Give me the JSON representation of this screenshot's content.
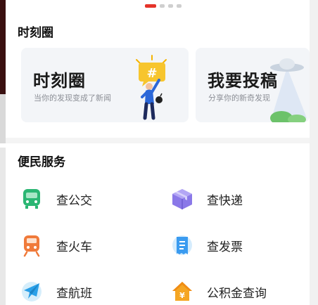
{
  "carousel": {
    "pages": 4,
    "active_index": 0,
    "active_color": "#e5332a"
  },
  "moments": {
    "section_title": "时刻圈",
    "cards": [
      {
        "title": "时刻圈",
        "subtitle": "当你的发现变成了新闻",
        "illustration": "person-hashtag-illustration"
      },
      {
        "title": "我要投稿",
        "subtitle": "分享你的新奇发现",
        "illustration": "ufo-beam-illustration"
      }
    ]
  },
  "services": {
    "section_title": "便民服务",
    "items": [
      {
        "label": "查公交",
        "icon": "bus-icon",
        "color": "#2bb673"
      },
      {
        "label": "查快递",
        "icon": "package-icon",
        "color": "#8a78e8"
      },
      {
        "label": "查火车",
        "icon": "train-icon",
        "color": "#f07a3a"
      },
      {
        "label": "查发票",
        "icon": "invoice-icon",
        "color": "#3a9bf0"
      },
      {
        "label": "查航班",
        "icon": "airplane-icon",
        "color": "#2aa0e8"
      },
      {
        "label": "公积金查询",
        "icon": "housing-fund-icon",
        "color": "#f5a623"
      }
    ]
  }
}
